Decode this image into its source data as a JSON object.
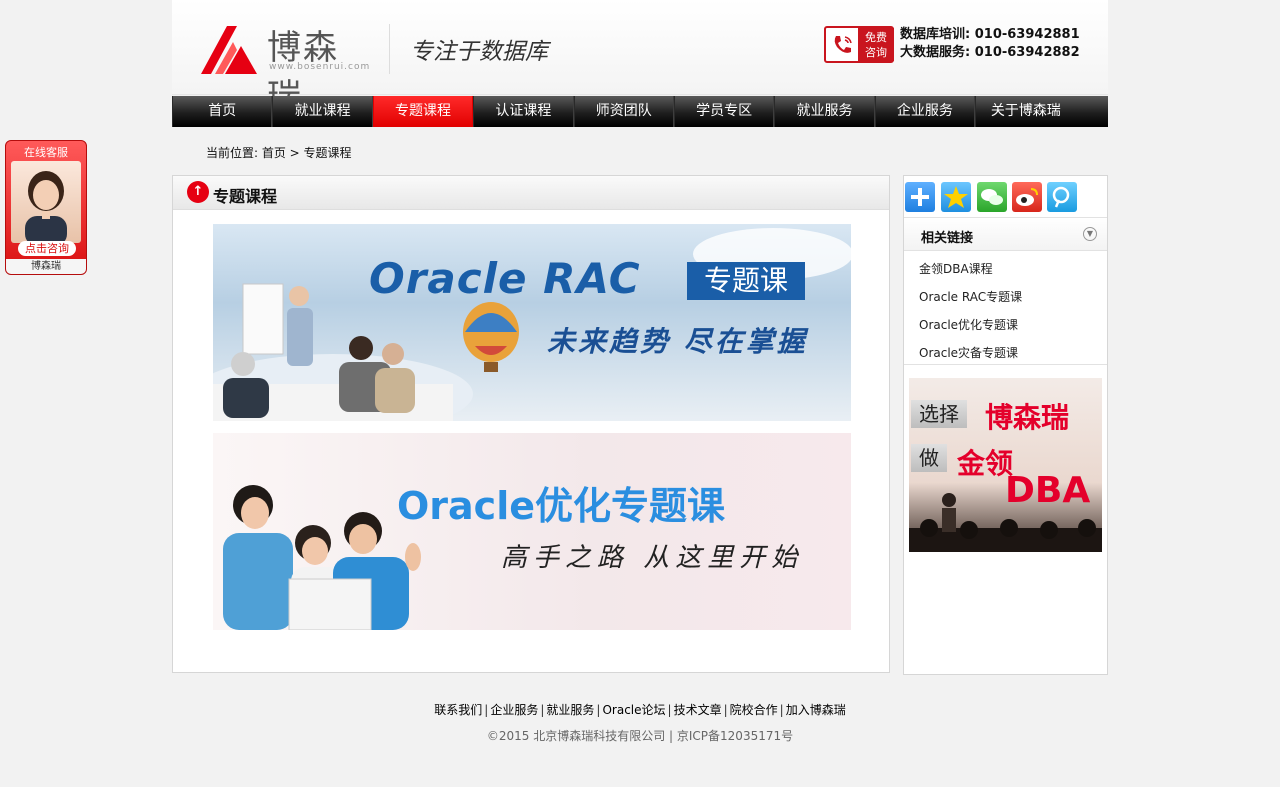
{
  "header": {
    "logo_cn": "博森瑞",
    "logo_en": "www.bosenrui.com",
    "slogan": "专注于数据库",
    "phone_tag_line1": "免费",
    "phone_tag_line2": "咨询",
    "hotline1": "数据库培训: 010-63942881",
    "hotline2": "大数据服务: 010-63942882"
  },
  "nav": {
    "items": [
      "首页",
      "就业课程",
      "专题课程",
      "认证课程",
      "师资团队",
      "学员专区",
      "就业服务",
      "企业服务",
      "关于博森瑞"
    ],
    "active_index": 2
  },
  "breadcrumb": "当前位置: 首页 > 专题课程",
  "main": {
    "title": "专题课程",
    "icon_glyph": "↑",
    "banner1": {
      "title": "Oracle RAC",
      "tag": "专题课",
      "subtitle": "未来趋势 尽在掌握"
    },
    "banner2": {
      "title": "Oracle优化专题课",
      "subtitle": "高手之路 从这里开始"
    }
  },
  "sidebar": {
    "share_icons": [
      "add-share-icon",
      "qzone-icon",
      "wechat-icon",
      "weibo-icon",
      "tencent-weibo-icon"
    ],
    "links_title": "相关链接",
    "links": [
      "金领DBA课程",
      "Oracle RAC专题课",
      "Oracle优化专题课",
      "Oracle灾备专题课"
    ],
    "ad": {
      "line1_label": "选择",
      "line1_red": "博森瑞",
      "line2_label": "做",
      "line2_red": "金领",
      "line3": "DBA"
    }
  },
  "kefu": {
    "top": "在线客服",
    "button": "点击咨询",
    "brand": "博森瑞"
  },
  "footer": {
    "links": [
      "联系我们",
      "企业服务",
      "就业服务",
      "Oracle论坛",
      "技术文章",
      "院校合作",
      "加入博森瑞"
    ],
    "copyright": "©2015 北京博森瑞科技有限公司 | 京ICP备12035171号"
  },
  "colors": {
    "brand_red": "#e60012",
    "nav_active": "#f00000",
    "banner_blue": "#1a5ea8"
  }
}
